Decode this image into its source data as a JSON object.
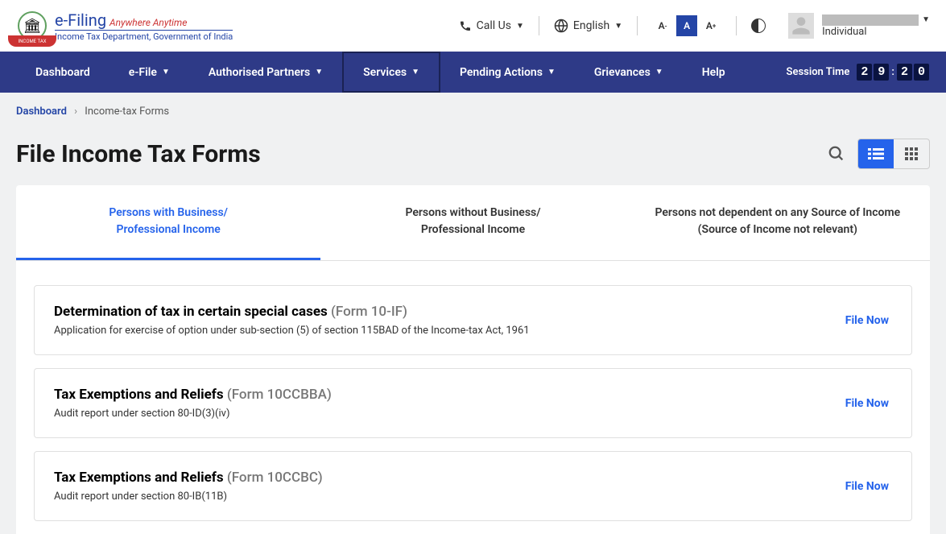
{
  "header": {
    "logo": {
      "title": "e-Filing",
      "tagline": "Anywhere Anytime",
      "subtitle": "Income Tax Department, Government of India"
    },
    "call_us": "Call Us",
    "language": "English",
    "user": {
      "role": "Individual"
    }
  },
  "nav": {
    "items": [
      {
        "label": "Dashboard",
        "dropdown": false
      },
      {
        "label": "e-File",
        "dropdown": true
      },
      {
        "label": "Authorised Partners",
        "dropdown": true
      },
      {
        "label": "Services",
        "dropdown": true,
        "active": true
      },
      {
        "label": "Pending Actions",
        "dropdown": true
      },
      {
        "label": "Grievances",
        "dropdown": true
      },
      {
        "label": "Help",
        "dropdown": false
      }
    ],
    "session_label": "Session Time",
    "session_digits": [
      "2",
      "9",
      ":",
      "2",
      "0"
    ]
  },
  "breadcrumb": {
    "link": "Dashboard",
    "current": "Income-tax Forms"
  },
  "page": {
    "title": "File Income Tax Forms"
  },
  "tabs": [
    {
      "line1": "Persons with Business/",
      "line2": "Professional Income",
      "active": true
    },
    {
      "line1": "Persons without Business/",
      "line2": "Professional Income",
      "active": false
    },
    {
      "line1": "Persons not dependent on any Source of Income",
      "line2": "(Source of Income not relevant)",
      "active": false
    }
  ],
  "forms": [
    {
      "title": "Determination of tax in certain special cases",
      "code": "(Form 10-IF)",
      "desc": "Application for exercise of option under sub-section (5) of section 115BAD of the Income-tax Act, 1961",
      "action": "File Now"
    },
    {
      "title": "Tax Exemptions and Reliefs",
      "code": "(Form 10CCBBA)",
      "desc": "Audit report under section 80-ID(3)(iv)",
      "action": "File Now"
    },
    {
      "title": "Tax Exemptions and Reliefs",
      "code": "(Form 10CCBC)",
      "desc": "Audit report under section 80-IB(11B)",
      "action": "File Now"
    }
  ]
}
